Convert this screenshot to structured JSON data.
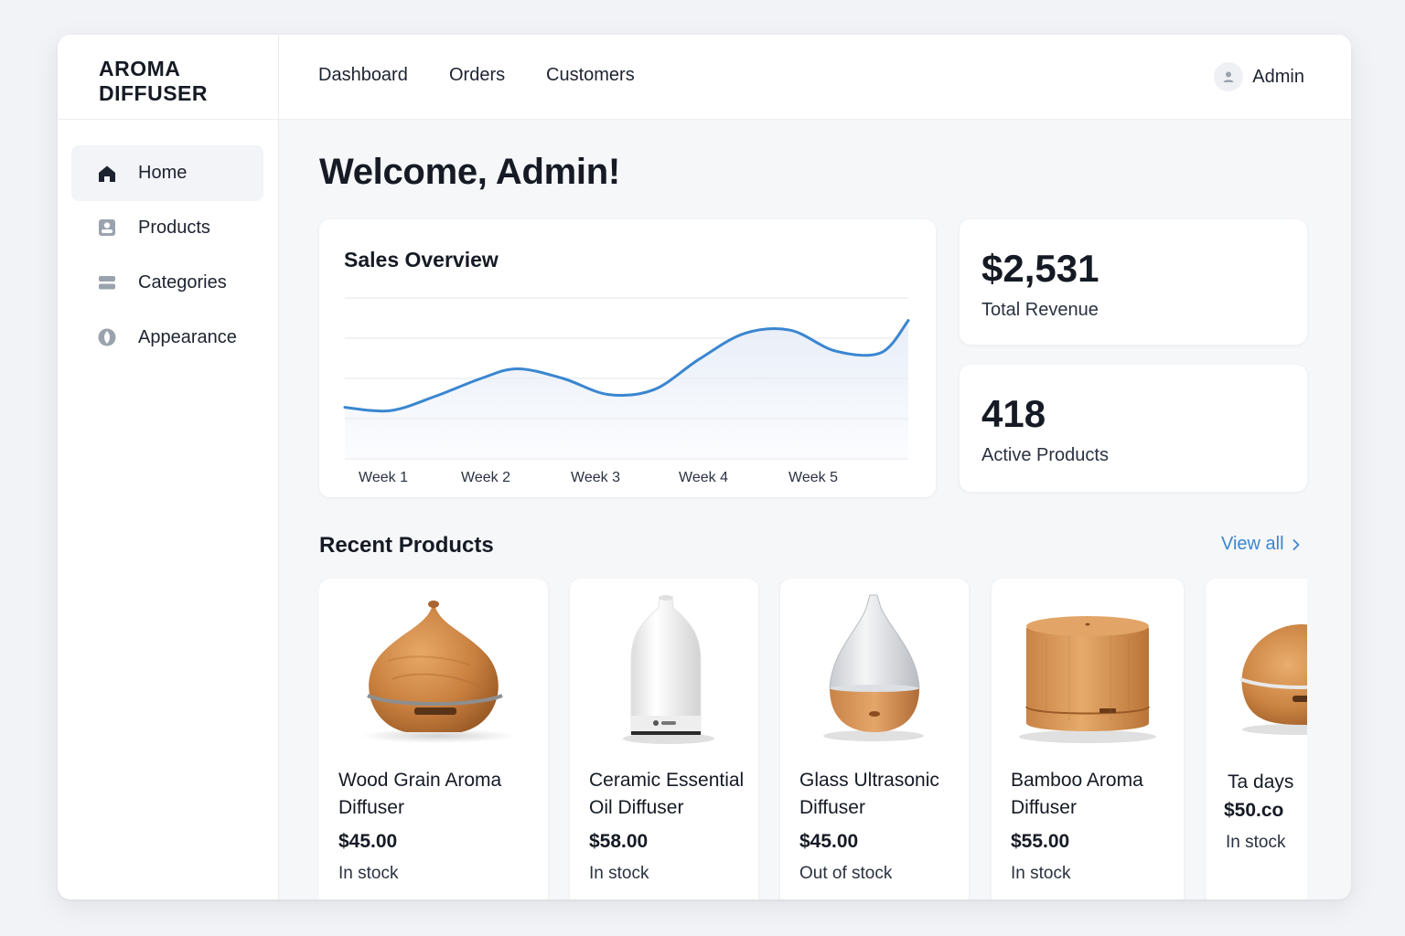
{
  "app": {
    "brand_line1": "AROMA",
    "brand_line2": "DIFFUSER"
  },
  "sidebar": {
    "items": [
      {
        "label": "Home",
        "icon": "home-icon",
        "active": true
      },
      {
        "label": "Products",
        "icon": "products-icon",
        "active": false
      },
      {
        "label": "Categories",
        "icon": "categories-icon",
        "active": false
      },
      {
        "label": "Appearance",
        "icon": "appearance-icon",
        "active": false
      }
    ]
  },
  "topbar": {
    "links": [
      "Dashboard",
      "Orders",
      "Customers"
    ],
    "user_name": "Admin"
  },
  "main": {
    "welcome": "Welcome, Admin!",
    "sales_card": {
      "title": "Sales Overview"
    },
    "stats": [
      {
        "value": "$2,531",
        "label": "Total Revenue"
      },
      {
        "value": "418",
        "label": "Active Products"
      }
    ],
    "recent": {
      "title": "Recent Products",
      "view_all": "View all",
      "products": [
        {
          "name": "Wood Grain Aroma Diffuser",
          "price": "$45.00",
          "stock": "In stock",
          "image": "wood-diffuser-image"
        },
        {
          "name": "Ceramic Essential Oil Diffuser",
          "price": "$58.00",
          "stock": "In stock",
          "image": "ceramic-diffuser-image"
        },
        {
          "name": "Glass Ultrasonic Diffuser",
          "price": "$45.00",
          "stock": "Out of stock",
          "image": "glass-diffuser-image"
        },
        {
          "name": "Bamboo Aroma Diffuser",
          "price": "$55.00",
          "stock": "In stock",
          "image": "bamboo-diffuser-image"
        },
        {
          "name": "Ta days",
          "price": "$50.co",
          "stock": "In stock",
          "image": "wood-diffuser-image"
        }
      ]
    }
  },
  "colors": {
    "accent": "#3a86d0",
    "line": "#3a86d0",
    "area": "#e8eef8"
  },
  "chart_data": {
    "type": "line",
    "title": "Sales Overview",
    "categories": [
      "Week 1",
      "Week 2",
      "Week 3",
      "Week 4",
      "Week 5"
    ],
    "x": [
      0.1,
      0.6,
      1.1,
      1.6,
      2.0,
      2.5,
      3.0,
      3.5,
      4.0,
      4.5,
      5.0,
      5.5,
      6.0,
      6.3
    ],
    "values": [
      3.2,
      3.0,
      3.9,
      5.0,
      5.6,
      5.0,
      4.0,
      4.3,
      6.2,
      7.8,
      8.0,
      6.7,
      6.6,
      8.6
    ],
    "ylim": [
      0,
      10
    ],
    "xlim": [
      0.1,
      6.3
    ],
    "grid": true,
    "xlabel": "",
    "ylabel": ""
  }
}
